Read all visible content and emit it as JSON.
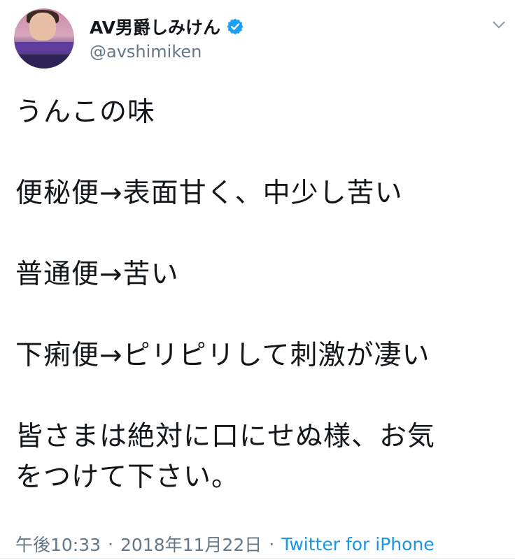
{
  "tweet": {
    "author": {
      "display_name": "AV男爵しみけん",
      "handle": "@avshimiken",
      "verified": true
    },
    "text_lines": [
      "うんこの味",
      "",
      "便秘便→表面甘く、中少し苦い",
      "",
      "普通便→苦い",
      "",
      "下痢便→ピリピリして刺激が凄い",
      "",
      "皆さまは絶対に口にせぬ様、お気",
      "をつけて下さい。"
    ],
    "timestamp": "午後10:33",
    "separator": "·",
    "date": "2018年11月22日",
    "source": "Twitter for iPhone"
  },
  "icons": {
    "verified": "verified-badge-icon",
    "menu": "chevron-down-icon",
    "avatar": "avatar"
  },
  "colors": {
    "text": "#14171a",
    "secondary": "#657786",
    "link": "#1b95e0",
    "verified": "#1da1f2"
  }
}
